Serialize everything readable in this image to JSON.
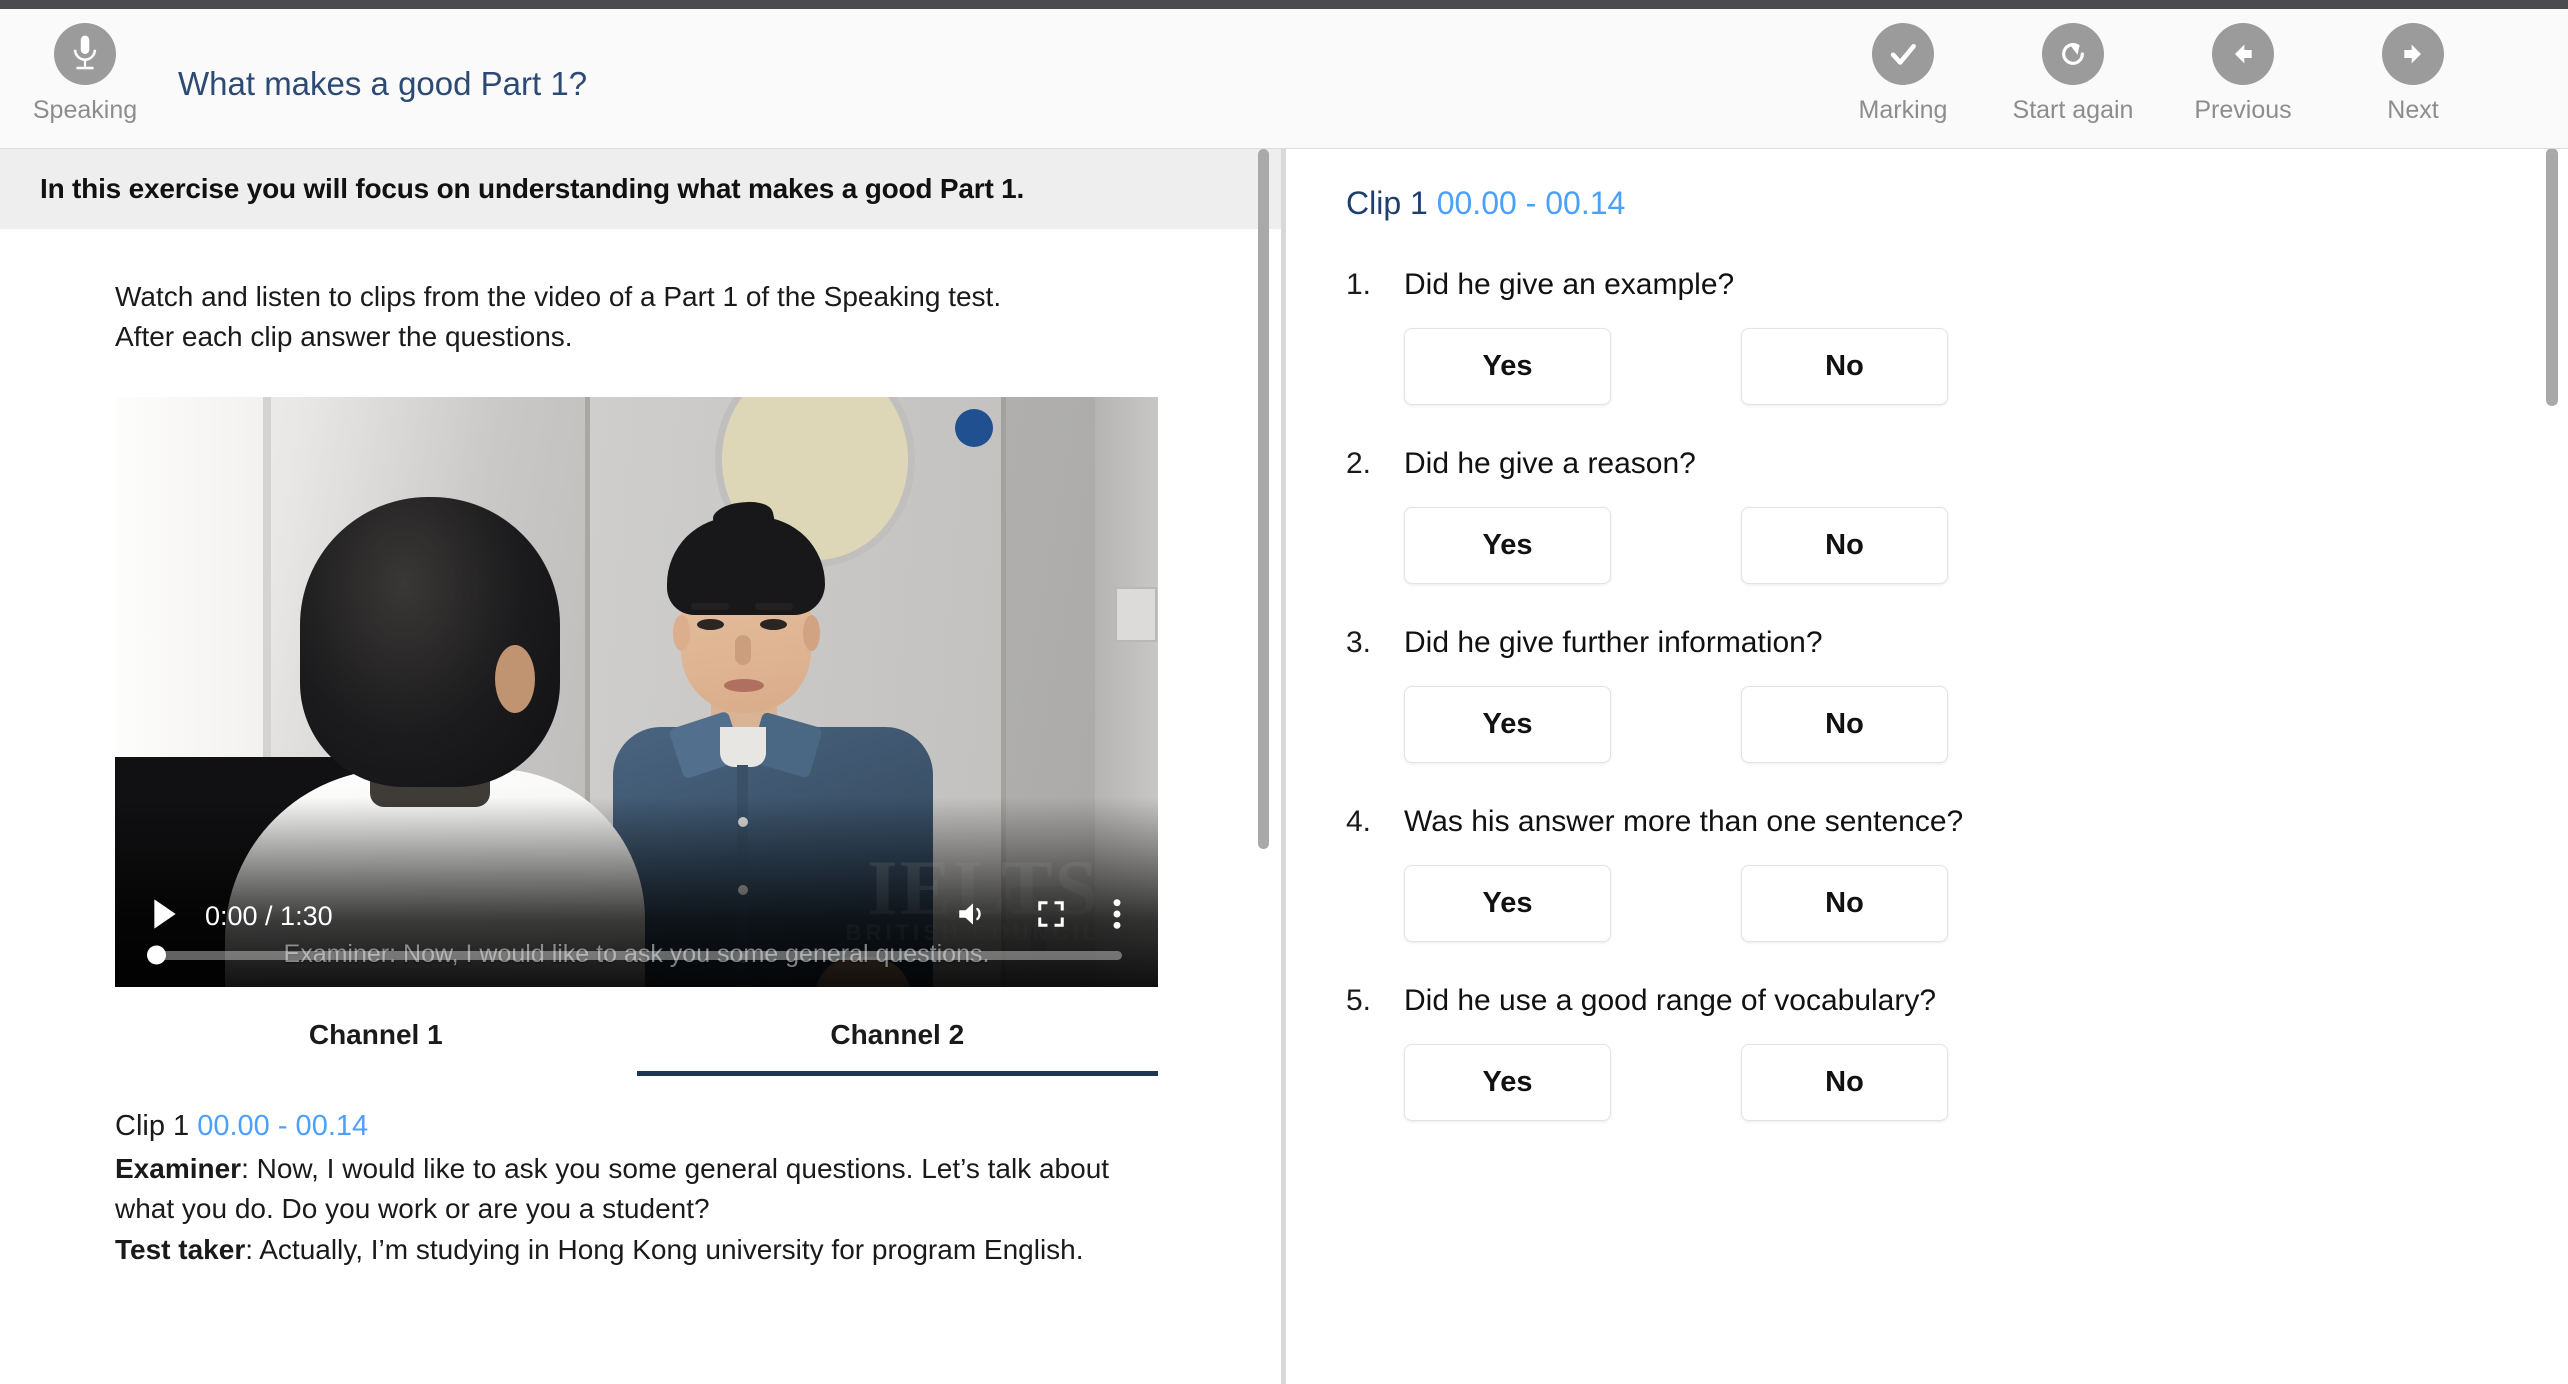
{
  "toolbar": {
    "left_tool": {
      "label": "Speaking",
      "icon": "microphone-icon"
    },
    "title": "What makes a good Part 1?",
    "right_tools": [
      {
        "label": "Marking",
        "icon": "check-icon"
      },
      {
        "label": "Start again",
        "icon": "restart-icon"
      },
      {
        "label": "Previous",
        "icon": "arrow-left-icon"
      },
      {
        "label": "Next",
        "icon": "arrow-right-icon"
      }
    ]
  },
  "left": {
    "instruction": "In this exercise you will focus on understanding what makes a good Part 1.",
    "intro_line_1": "Watch and listen to clips from the video of a Part 1 of the Speaking test.",
    "intro_line_2": "After each clip answer the questions.",
    "video": {
      "current_time": "0:00",
      "duration": "1:30",
      "time_display": "0:00 / 1:30",
      "progress_percent": 0,
      "subtitle": "Examiner: Now, I would like to ask you some general questions.",
      "watermark": "IELTS",
      "watermark_sub": "BRITISH COUNCIL",
      "controls": [
        "play-icon",
        "volume-icon",
        "fullscreen-icon",
        "more-options-icon"
      ]
    },
    "tabs": [
      {
        "label": "Channel 1",
        "active": false
      },
      {
        "label": "Channel 2",
        "active": true
      }
    ],
    "transcript": {
      "clip_name": "Clip 1",
      "clip_time": "00.00 - 00.14",
      "examiner_speaker": "Examiner",
      "examiner_text": ": Now, I would like to ask you some general questions. Let’s talk about what you do. Do you work or are you a student?",
      "testtaker_speaker": "Test taker",
      "testtaker_text": ": Actually, I’m studying in Hong Kong university for program English."
    }
  },
  "right": {
    "clip_name": "Clip 1",
    "clip_time": "00.00 - 00.14",
    "yes_label": "Yes",
    "no_label": "No",
    "questions": [
      {
        "num": "1.",
        "text": "Did he give an example?"
      },
      {
        "num": "2.",
        "text": "Did he give a reason?"
      },
      {
        "num": "3.",
        "text": "Did he give further information?"
      },
      {
        "num": "4.",
        "text": "Was his answer more than one sentence?"
      },
      {
        "num": "5.",
        "text": "Did he use a good range of vocabulary?"
      }
    ]
  },
  "colors": {
    "title_blue": "#2c4a73",
    "clip_time_blue": "#4da0f7",
    "tab_underline": "#1d3557",
    "icon_circle_gray": "#9b9b9b",
    "instruction_bg": "#eeeeee"
  }
}
